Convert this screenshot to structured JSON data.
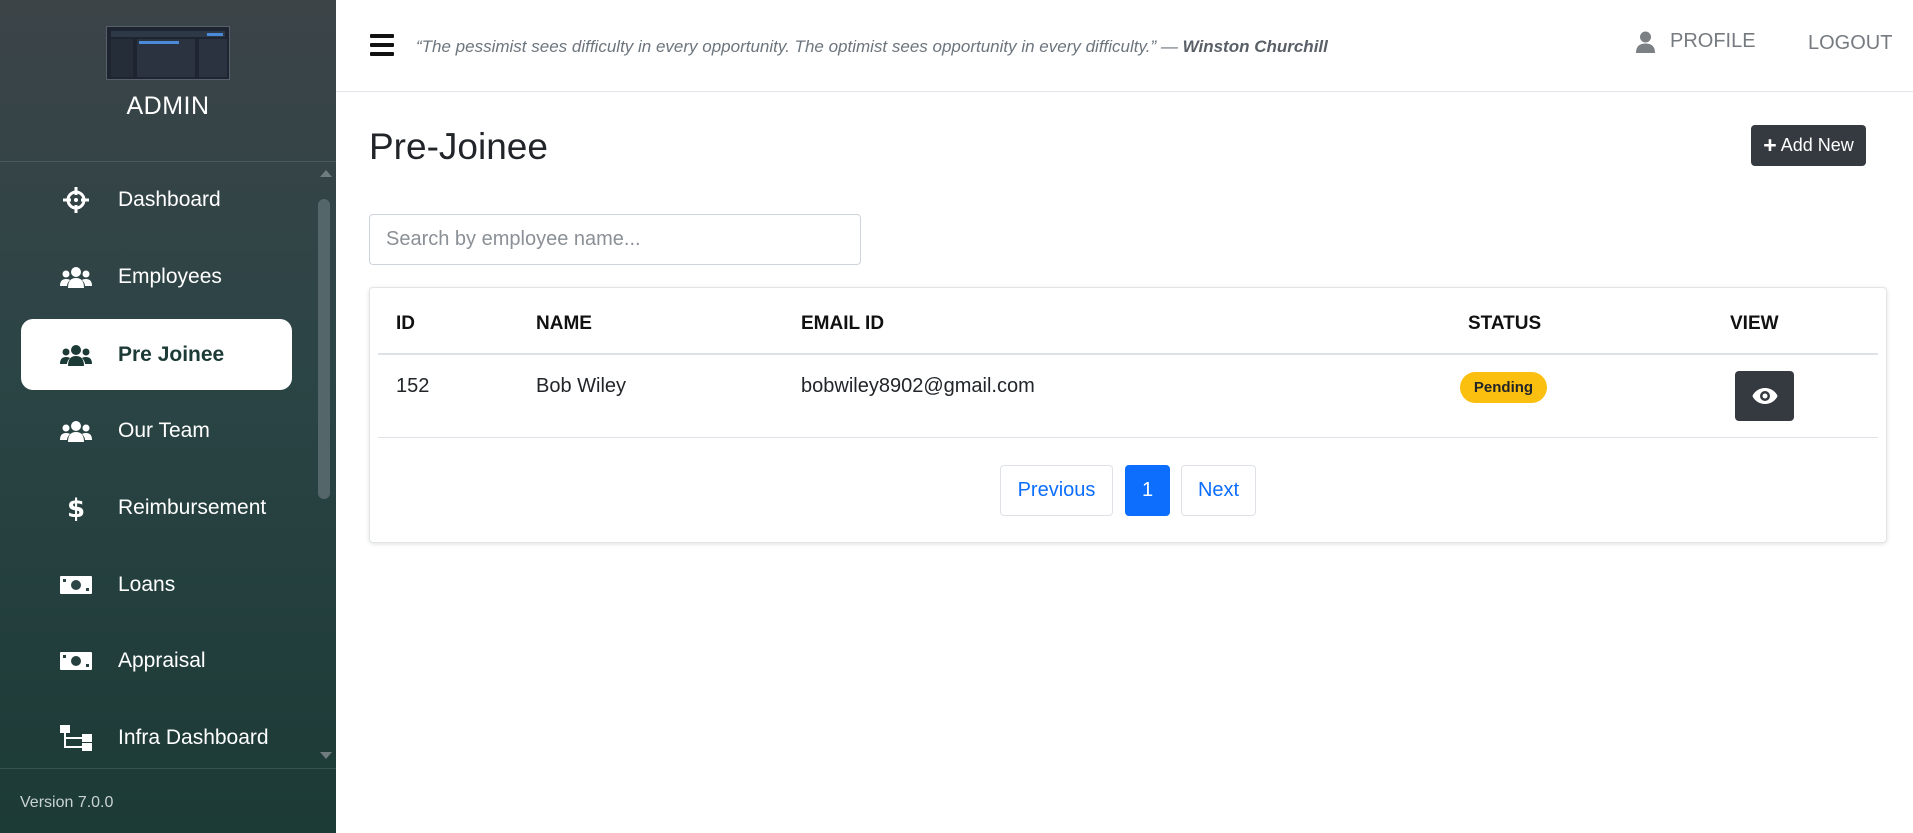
{
  "sidebar": {
    "brand_title": "ADMIN",
    "version": "Version 7.0.0",
    "items": [
      {
        "label": "Dashboard",
        "icon": "crosshairs-icon",
        "active": false
      },
      {
        "label": "Employees",
        "icon": "users-icon",
        "active": false
      },
      {
        "label": "Pre Joinee",
        "icon": "users-icon",
        "active": true
      },
      {
        "label": "Our Team",
        "icon": "users-icon",
        "active": false
      },
      {
        "label": "Reimbursement",
        "icon": "dollar-icon",
        "active": false
      },
      {
        "label": "Loans",
        "icon": "money-bill-icon",
        "active": false
      },
      {
        "label": "Appraisal",
        "icon": "money-bill-icon",
        "active": false
      },
      {
        "label": "Infra Dashboard",
        "icon": "sitemap-icon",
        "active": false
      }
    ]
  },
  "header": {
    "quote_text": "“The pessimist sees difficulty in every opportunity. The optimist sees opportunity in every difficulty.” —",
    "quote_author": "Winston Churchill",
    "profile_label": "PROFILE",
    "logout_label": "LOGOUT"
  },
  "main": {
    "title": "Pre-Joinee",
    "add_button_label": "Add New",
    "search_placeholder": "Search by employee name...",
    "table": {
      "columns": [
        "ID",
        "NAME",
        "EMAIL ID",
        "STATUS",
        "VIEW"
      ],
      "rows": [
        {
          "id": "152",
          "name": "Bob Wiley",
          "email": "bobwiley8902@gmail.com",
          "status": "Pending"
        }
      ]
    },
    "pagination": {
      "previous_label": "Previous",
      "current_page": "1",
      "next_label": "Next"
    }
  },
  "colors": {
    "accent": "#0d6efd",
    "dark_button": "#343a40",
    "status_pending": "#fbbf10",
    "sidebar_top": "#3c4448",
    "sidebar_bottom": "#1c3a36"
  }
}
